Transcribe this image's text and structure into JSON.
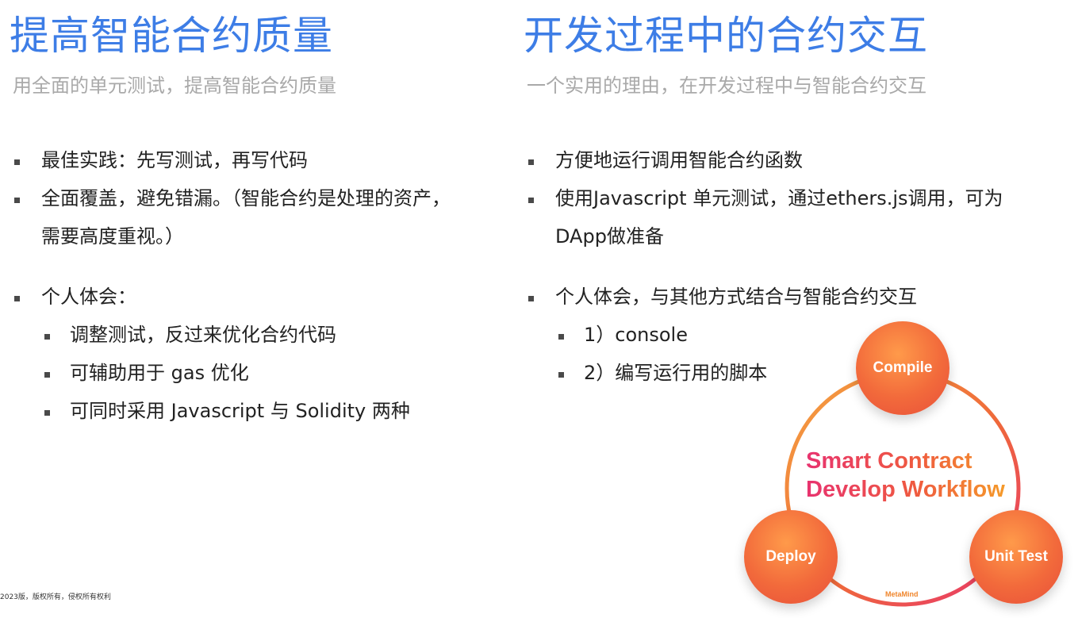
{
  "left": {
    "title": "提高智能合约质量",
    "subtitle": "用全面的单元测试，提高智能合约质量",
    "bullets": [
      "最佳实践：先写测试，再写代码",
      "全面覆盖，避免错漏。（智能合约是处理的资产，",
      "需要高度重视。）",
      "个人体会："
    ],
    "sub_bullets": [
      "调整测试，反过来优化合约代码",
      "可辅助用于 gas 优化",
      "可同时采用 Javascript 与 Solidity 两种"
    ]
  },
  "right": {
    "title": "开发过程中的合约交互",
    "subtitle": "一个实用的理由，在开发过程中与智能合约交互",
    "bullets": [
      "方便地运行调用智能合约函数",
      "使用Javascript 单元测试，通过ethers.js调用，可为",
      "DApp做准备",
      "个人体会，与其他方式结合与智能合约交互"
    ],
    "sub_bullets": [
      "1）console",
      "2）编写运行用的脚本"
    ]
  },
  "workflow": {
    "title_line1": "Smart Contract",
    "title_line2": "Develop Workflow",
    "node_compile": "Compile",
    "node_deploy": "Deploy",
    "node_unit_test": "Unit Test",
    "brand": "MetaMind",
    "colors": {
      "node": "#f26a3b",
      "ring": "#f0862c",
      "title_start": "#e8336f",
      "title_end": "#f59a2a",
      "heading": "#3d7de6"
    }
  },
  "footer": "2023版，版权所有，侵权所有权利"
}
